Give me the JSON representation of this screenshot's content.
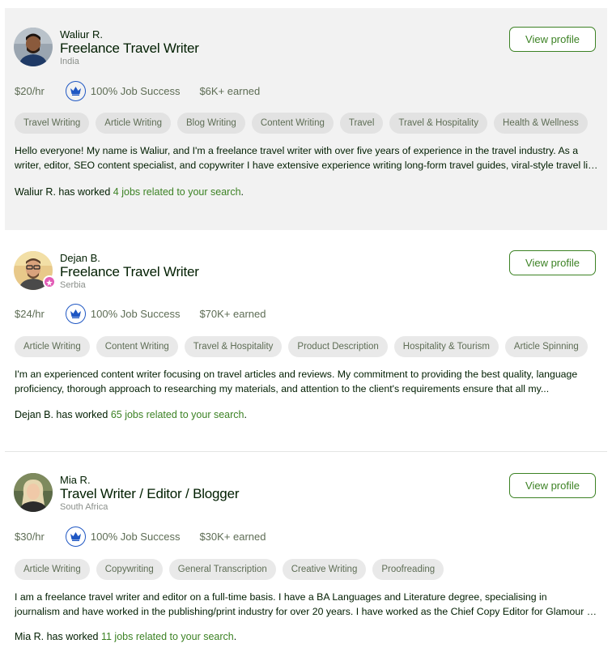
{
  "freelancers": [
    {
      "name": "Waliur R.",
      "title": "Freelance Travel Writer",
      "country": "India",
      "rate": "$20/hr",
      "job_success": "100% Job Success",
      "earned": "$6K+ earned",
      "view_label": "View profile",
      "skills": [
        "Travel Writing",
        "Article Writing",
        "Blog Writing",
        "Content Writing",
        "Travel",
        "Travel & Hospitality",
        "Health & Wellness"
      ],
      "desc_line1": "Hello everyone! My name is Waliur, and I'm a freelance travel writer with over five years of experience in the travel industry. As a",
      "desc_line2": "writer, editor, SEO content specialist, and copywriter I have extensive experience writing long-form travel guides, viral-style travel listicles, and more.",
      "worked_prefix": "Waliur R. has worked",
      "worked_link": "4 jobs related to your search",
      "worked_suffix": "."
    },
    {
      "name": "Dejan B.",
      "title": "Freelance Travel Writer",
      "country": "Serbia",
      "rate": "$24/hr",
      "job_success": "100% Job Success",
      "earned": "$70K+ earned",
      "view_label": "View profile",
      "skills": [
        "Article Writing",
        "Content Writing",
        "Travel & Hospitality",
        "Product Description",
        "Hospitality & Tourism",
        "Article Spinning"
      ],
      "desc_line1": "I'm an experienced content writer focusing on travel articles and reviews. My commitment to providing the best quality, language",
      "desc_line2": "proficiency, thorough approach to researching my materials, and attention to the client's requirements ensure that all my...",
      "worked_prefix": "Dejan B. has worked",
      "worked_link": "65 jobs related to your search",
      "worked_suffix": "."
    },
    {
      "name": "Mia R.",
      "title": "Travel Writer / Editor / Blogger",
      "country": "South Africa",
      "rate": "$30/hr",
      "job_success": "100% Job Success",
      "earned": "$30K+ earned",
      "view_label": "View profile",
      "skills": [
        "Article Writing",
        "Copywriting",
        "General Transcription",
        "Creative Writing",
        "Proofreading"
      ],
      "desc_line1": "I am a freelance travel writer and editor on a full-time basis. I have a BA Languages and Literature degree, specialising in",
      "desc_line2": "journalism and have worked in the publishing/print industry for over 20 years. I have worked as the Chief Copy Editor for Glamour magazine.",
      "worked_prefix": "Mia R. has worked",
      "worked_link": "11 jobs related to your search",
      "worked_suffix": "."
    }
  ]
}
